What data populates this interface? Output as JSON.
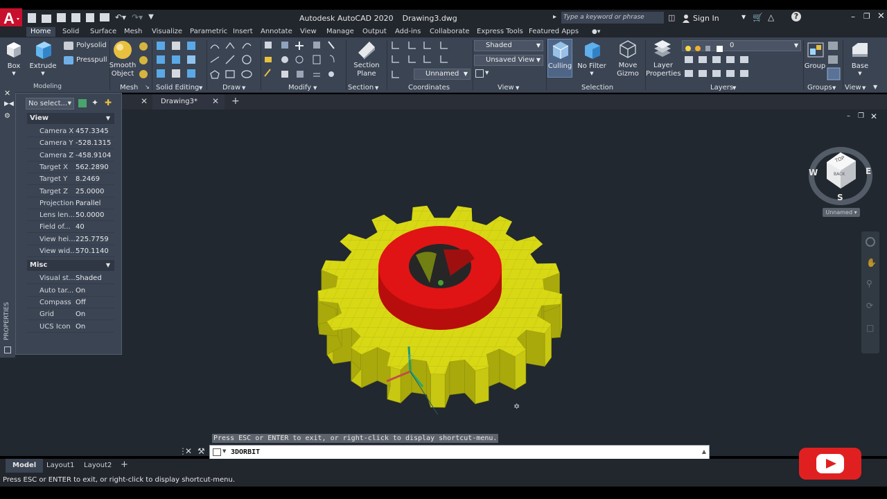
{
  "app": {
    "title": "Autodesk AutoCAD 2020",
    "document": "Drawing3.dwg",
    "search_placeholder": "Type a keyword or phrase",
    "sign_in": "Sign In"
  },
  "ribbon_tabs": [
    "Home",
    "Solid",
    "Surface",
    "Mesh",
    "Visualize",
    "Parametric",
    "Insert",
    "Annotate",
    "View",
    "Manage",
    "Output",
    "Add-ins",
    "Collaborate",
    "Express Tools",
    "Featured Apps"
  ],
  "ribbon": {
    "buttons": {
      "box": "Box",
      "extrude": "Extrude",
      "polysolid": "Polysolid",
      "presspull": "Presspull",
      "smooth_object": "Smooth Object",
      "section_plane": "Section Plane",
      "culling": "Culling",
      "no_filter": "No Filter",
      "move_gizmo": "Move Gizmo",
      "layer_properties": "Layer Properties",
      "group": "Group",
      "base": "Base"
    },
    "combos": {
      "visual_style": "Shaded",
      "view": "Unsaved View",
      "ucs": "Unnamed",
      "layer": "0"
    },
    "panels": [
      "Mesh",
      "Solid Editing",
      "Draw",
      "Modify",
      "Section",
      "Coordinates",
      "View",
      "Selection",
      "Layers",
      "Groups",
      "View"
    ]
  },
  "doc_tab": "Drawing3*",
  "properties": {
    "selection": "No select...",
    "side_label": "PROPERTIES",
    "categories": [
      {
        "name": "View",
        "rows": [
          {
            "k": "Camera X",
            "v": "457.3345"
          },
          {
            "k": "Camera Y",
            "v": "-528.1315"
          },
          {
            "k": "Camera Z",
            "v": "-458.9104"
          },
          {
            "k": "Target X",
            "v": "562.2890"
          },
          {
            "k": "Target Y",
            "v": "8.2469"
          },
          {
            "k": "Target Z",
            "v": "25.0000"
          },
          {
            "k": "Projection",
            "v": "Parallel"
          },
          {
            "k": "Lens len...",
            "v": "50.0000"
          },
          {
            "k": "Field of...",
            "v": "40"
          },
          {
            "k": "View hei...",
            "v": "225.7759"
          },
          {
            "k": "View wid...",
            "v": "570.1140"
          }
        ]
      },
      {
        "name": "Misc",
        "rows": [
          {
            "k": "Visual st...",
            "v": "Shaded"
          },
          {
            "k": "Auto tar...",
            "v": "On"
          },
          {
            "k": "Compass",
            "v": "Off"
          },
          {
            "k": "Grid",
            "v": "On"
          },
          {
            "k": "UCS Icon",
            "v": "On"
          }
        ]
      }
    ]
  },
  "viewcube": {
    "top": "TOP",
    "back": "BACK",
    "west": "W",
    "east": "E",
    "south": "S",
    "ucs": "Unnamed"
  },
  "ucs_axis": "Z",
  "command": {
    "prompt": "Press ESC or ENTER to exit, or right-click to display shortcut-menu.",
    "current": "3DORBIT"
  },
  "layout_tabs": [
    "Model",
    "Layout1",
    "Layout2"
  ],
  "status": "Press ESC or ENTER to exit, or right-click to display shortcut-menu.",
  "colors": {
    "gear": "#d8d815",
    "hub": "#e01010",
    "accent": "#e02020"
  }
}
